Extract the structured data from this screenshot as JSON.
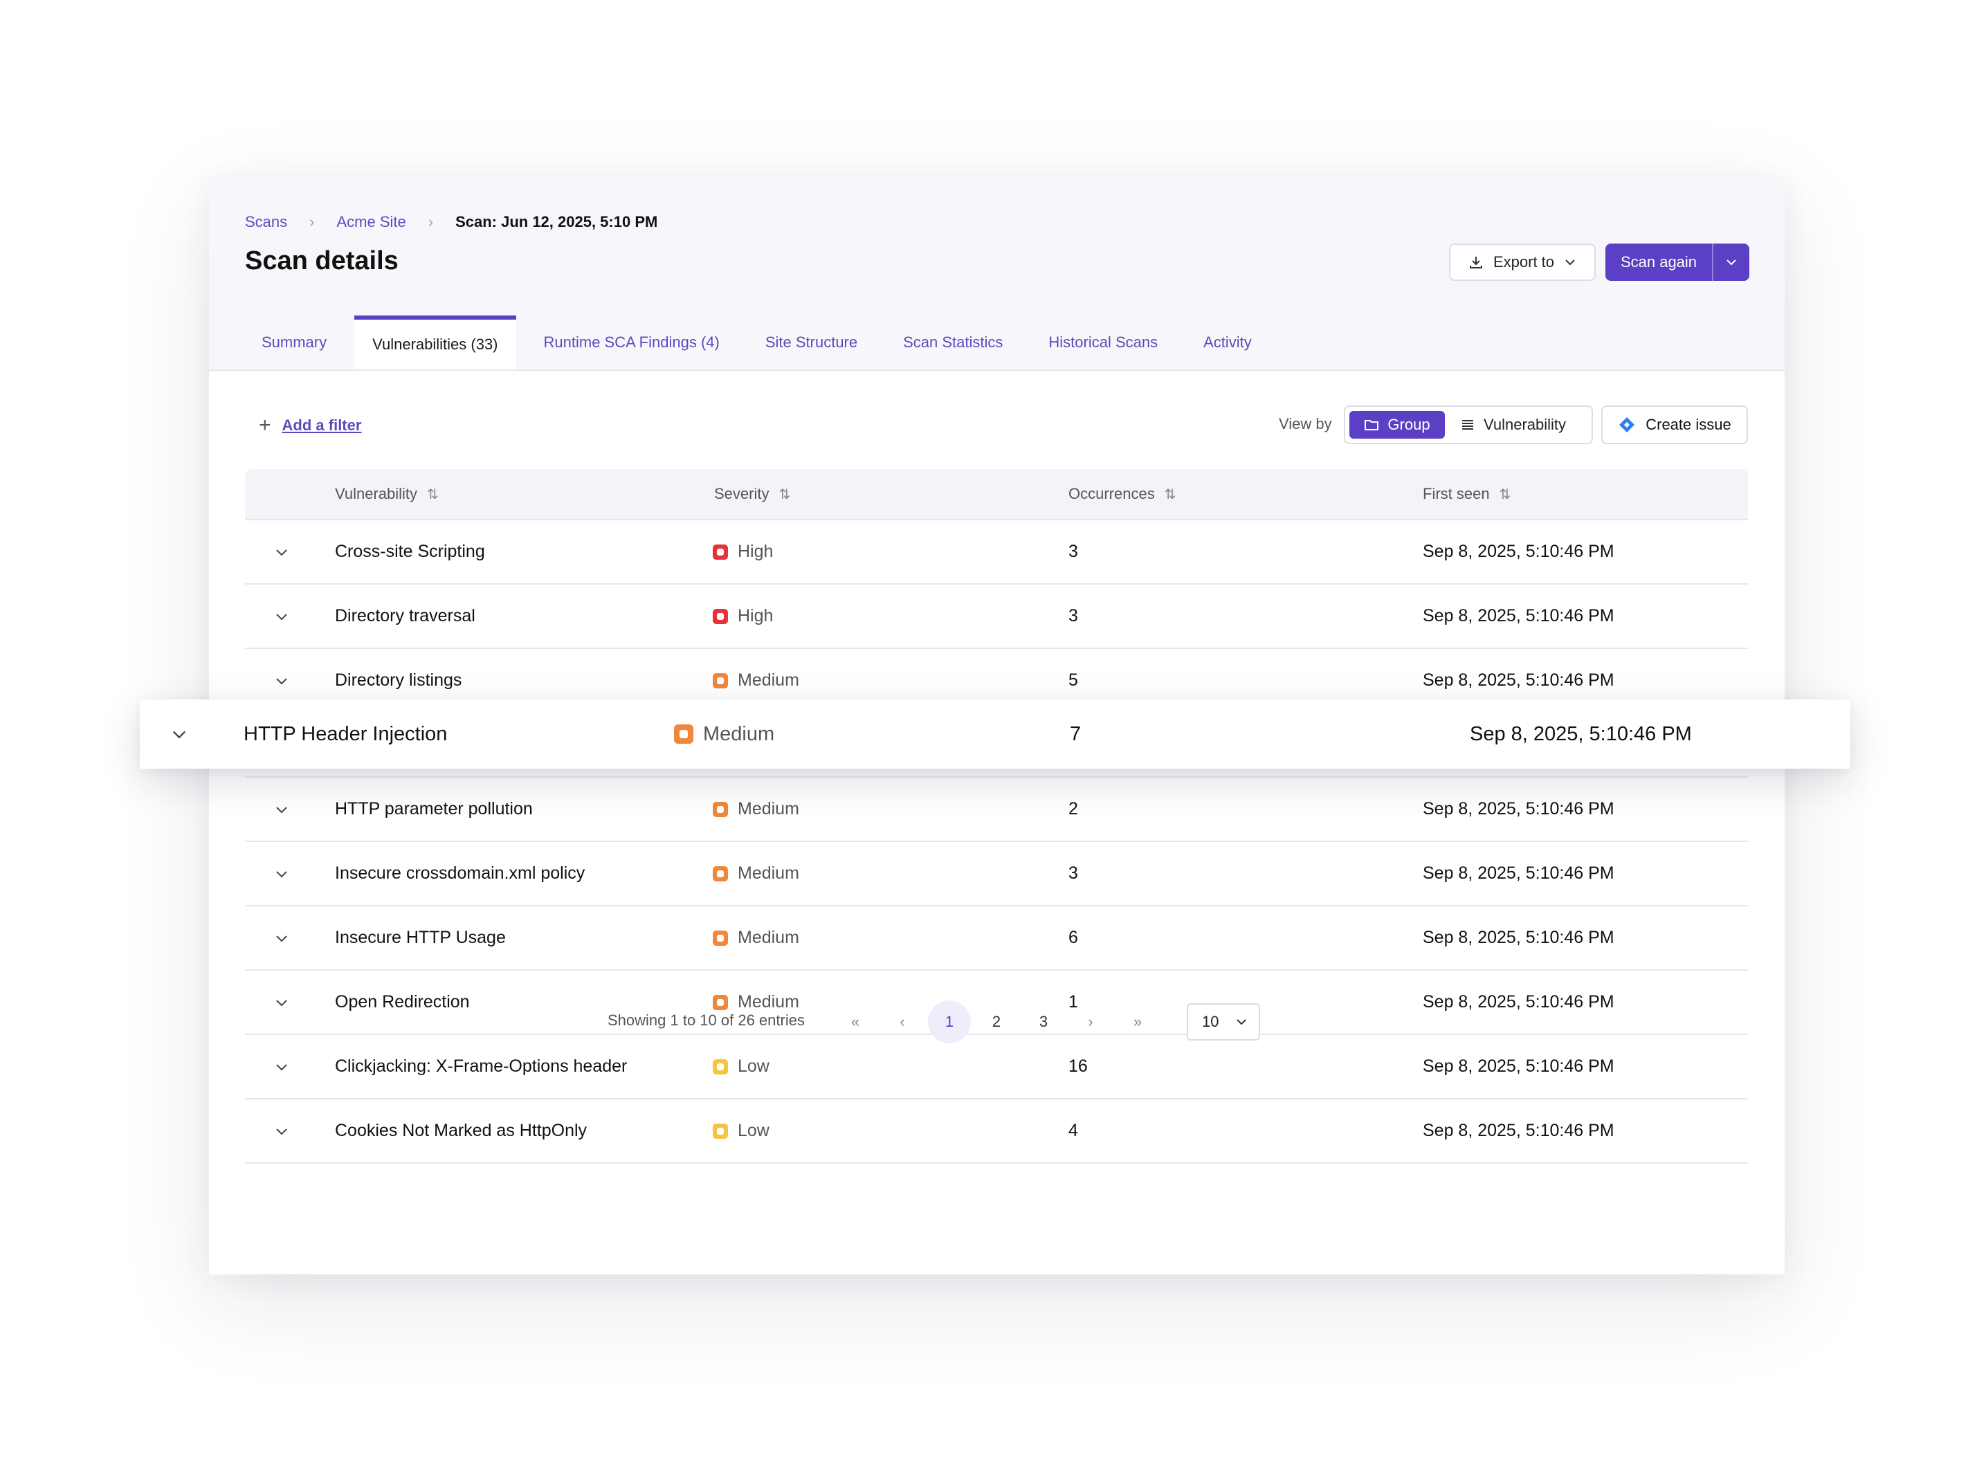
{
  "breadcrumb": {
    "items": [
      "Scans",
      "Acme Site"
    ],
    "current": "Scan: Jun 12, 2025, 5:10 PM"
  },
  "page": {
    "title": "Scan details"
  },
  "actions": {
    "export_label": "Export to",
    "scan_again_label": "Scan again"
  },
  "tabs": [
    {
      "label": "Summary"
    },
    {
      "label": "Vulnerabilities (33)",
      "active": true
    },
    {
      "label": "Runtime SCA Findings (4)"
    },
    {
      "label": "Site Structure"
    },
    {
      "label": "Scan Statistics"
    },
    {
      "label": "Historical Scans"
    },
    {
      "label": "Activity"
    }
  ],
  "toolbar": {
    "add_filter": "Add a filter",
    "view_by_label": "View by",
    "view_group": "Group",
    "view_vulnerability": "Vulnerability",
    "create_issue": "Create issue"
  },
  "table": {
    "columns": [
      "Vulnerability",
      "Severity",
      "Occurrences",
      "First seen"
    ],
    "rows": [
      {
        "name": "Cross-site Scripting",
        "severity": "High",
        "occurrences": "3",
        "first_seen": "Sep 8, 2025, 5:10:46 PM"
      },
      {
        "name": "Directory traversal",
        "severity": "High",
        "occurrences": "3",
        "first_seen": "Sep 8, 2025, 5:10:46 PM"
      },
      {
        "name": "Directory listings",
        "severity": "Medium",
        "occurrences": "5",
        "first_seen": "Sep 8, 2025, 5:10:46 PM"
      },
      {
        "name": "HTTP Header Injection",
        "severity": "Medium",
        "occurrences": "7",
        "first_seen": "Sep 8, 2025, 5:10:46 PM"
      },
      {
        "name": "HTTP parameter pollution",
        "severity": "Medium",
        "occurrences": "2",
        "first_seen": "Sep 8, 2025, 5:10:46 PM"
      },
      {
        "name": "Insecure crossdomain.xml policy",
        "severity": "Medium",
        "occurrences": "3",
        "first_seen": "Sep 8, 2025, 5:10:46 PM"
      },
      {
        "name": "Insecure HTTP Usage",
        "severity": "Medium",
        "occurrences": "6",
        "first_seen": "Sep 8, 2025, 5:10:46 PM"
      },
      {
        "name": "Open Redirection",
        "severity": "Medium",
        "occurrences": "1",
        "first_seen": "Sep 8, 2025, 5:10:46 PM"
      },
      {
        "name": "Clickjacking: X-Frame-Options header",
        "severity": "Low",
        "occurrences": "16",
        "first_seen": "Sep 8, 2025, 5:10:46 PM"
      },
      {
        "name": "Cookies Not Marked as HttpOnly",
        "severity": "Low",
        "occurrences": "4",
        "first_seen": "Sep 8, 2025, 5:10:46 PM"
      }
    ]
  },
  "severity_colors": {
    "High": "#e8323a",
    "Medium": "#f0873a",
    "Low": "#f5c542"
  },
  "pagination": {
    "info": "Showing 1 to 10 of 26 entries",
    "pages": [
      "1",
      "2",
      "3"
    ],
    "current_page": "1",
    "page_size": "10"
  },
  "icons": [
    "download-icon",
    "chevron-down-icon",
    "plus-icon",
    "folder-icon",
    "list-icon",
    "jira-diamond-icon",
    "sort-icon",
    "chevron-right-icon"
  ]
}
